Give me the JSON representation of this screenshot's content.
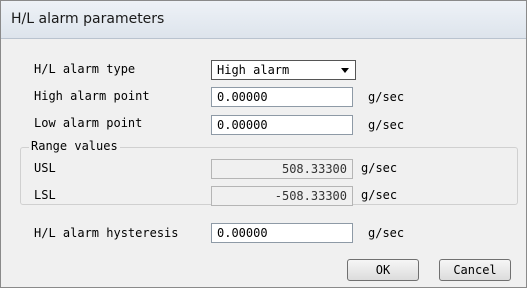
{
  "window": {
    "title": "H/L alarm parameters"
  },
  "form": {
    "alarm_type_label": "H/L alarm type",
    "alarm_type_value": "High alarm",
    "high_point_label": "High alarm point",
    "high_point_value": "0.00000",
    "high_point_unit": "g/sec",
    "low_point_label": "Low alarm point",
    "low_point_value": "0.00000",
    "low_point_unit": "g/sec"
  },
  "range": {
    "title": "Range values",
    "usl_label": "USL",
    "usl_value": "508.33300",
    "usl_unit": "g/sec",
    "lsl_label": "LSL",
    "lsl_value": "-508.33300",
    "lsl_unit": "g/sec"
  },
  "hysteresis": {
    "label": "H/L alarm hysteresis",
    "value": "0.00000",
    "unit": "g/sec"
  },
  "buttons": {
    "ok": "OK",
    "cancel": "Cancel"
  }
}
